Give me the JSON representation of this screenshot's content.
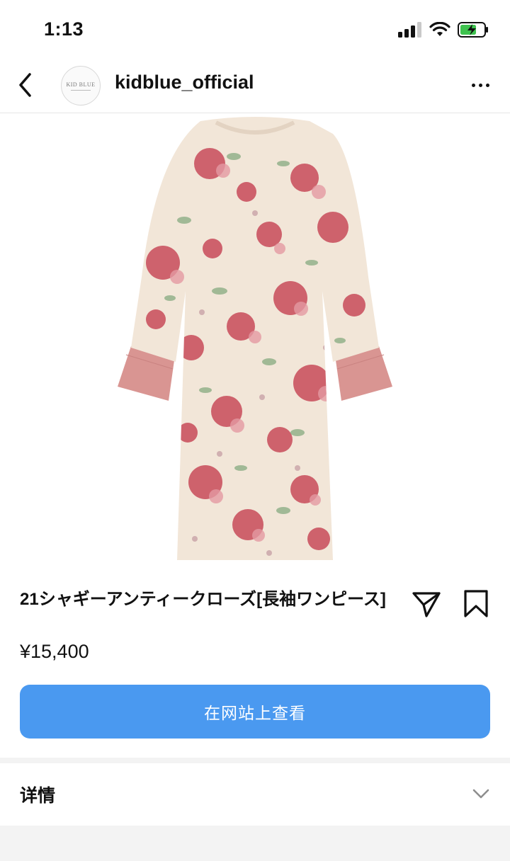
{
  "status_bar": {
    "time": "1:13"
  },
  "header": {
    "back_icon": "chevron-left-icon",
    "avatar_text": "KID BLUE",
    "username": "kidblue_official",
    "more_icon": "more-horizontal-icon"
  },
  "product": {
    "image_alt": "floral long-sleeve dress",
    "title": "21シャギーアンティークローズ[長袖ワンピース]",
    "price": "¥15,400",
    "share_icon": "send-icon",
    "save_icon": "bookmark-icon"
  },
  "cta": {
    "label": "在网站上查看"
  },
  "details": {
    "label": "详情",
    "chevron_icon": "chevron-down-icon"
  },
  "colors": {
    "accent": "#4a99f0",
    "dress_base": "#f2e6d8",
    "rose": "#c84a5a",
    "cuff": "#d99592",
    "leaf": "#7fa57a"
  }
}
